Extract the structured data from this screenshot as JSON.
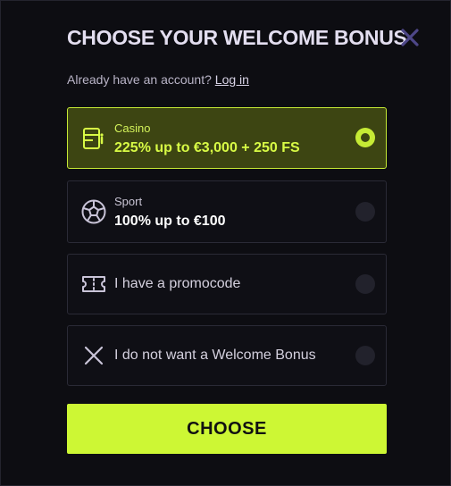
{
  "header": {
    "title": "CHOOSE YOUR WELCOME BONUS",
    "close_icon": "close-icon",
    "account_prompt": "Already have an account?",
    "login_label": "Log in"
  },
  "options": [
    {
      "id": "casino",
      "icon": "casino-card-icon",
      "category": "Casino",
      "offer": "225% up to €3,000 + 250 FS",
      "selected": true
    },
    {
      "id": "sport",
      "icon": "soccer-ball-icon",
      "category": "Sport",
      "offer": "100% up to €100",
      "selected": false
    },
    {
      "id": "promocode",
      "icon": "ticket-icon",
      "label": "I have a promocode",
      "selected": false
    },
    {
      "id": "no-bonus",
      "icon": "cross-icon",
      "label": "I do not want a Welcome Bonus",
      "selected": false
    }
  ],
  "choose_label": "CHOOSE",
  "colors": {
    "accent": "#cdf734",
    "selected_bg": "#3d4512",
    "modal_bg": "#0d0d12",
    "title": "#e3def0",
    "close": "#4e4788"
  }
}
